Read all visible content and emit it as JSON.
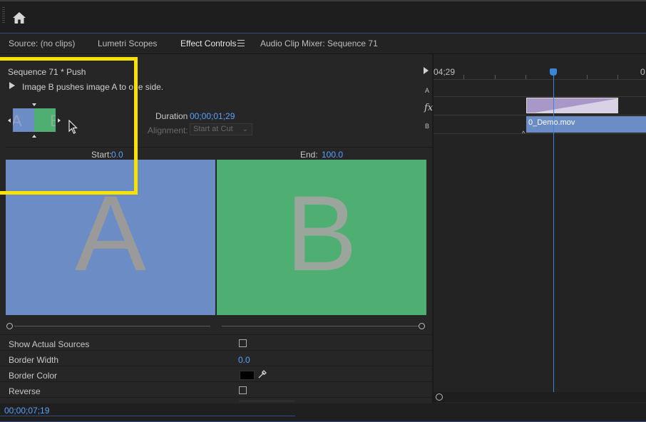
{
  "topbar": {
    "home_icon": "home-icon"
  },
  "tabs": [
    {
      "label": "Source: (no clips)"
    },
    {
      "label": "Lumetri Scopes"
    },
    {
      "label": "Effect Controls"
    },
    {
      "label": "Audio Clip Mixer: Sequence 71"
    }
  ],
  "effect": {
    "title": "Sequence 71 * Push",
    "description": "Image B pushes image A to one side.",
    "duration_label": "Duration",
    "duration_value": "00;00;01;29",
    "alignment_label": "Alignment:",
    "alignment_value": "Start at Cut",
    "start_label": "Start:",
    "start_value": "0.0",
    "end_label": "End:",
    "end_value": "100.0",
    "thumb_a": "A",
    "thumb_b": "B",
    "pane_a_letter": "A",
    "pane_b_letter": "B"
  },
  "properties": {
    "show_actual_sources": "Show Actual Sources",
    "border_width": "Border Width",
    "border_width_value": "0.0",
    "border_color": "Border Color",
    "reverse": "Reverse"
  },
  "timeline": {
    "time_start": "04;29",
    "time_end": "0",
    "track_a": "A",
    "track_fx": "fx",
    "track_b": "B",
    "clip_name": "0_Demo.mov"
  },
  "status": {
    "timecode": "00;00;07;19"
  },
  "colors": {
    "accent_blue": "#5aa0ff",
    "highlight_yellow": "#f6e100",
    "pane_a": "#6b8cc4",
    "pane_b": "#4fae72"
  }
}
